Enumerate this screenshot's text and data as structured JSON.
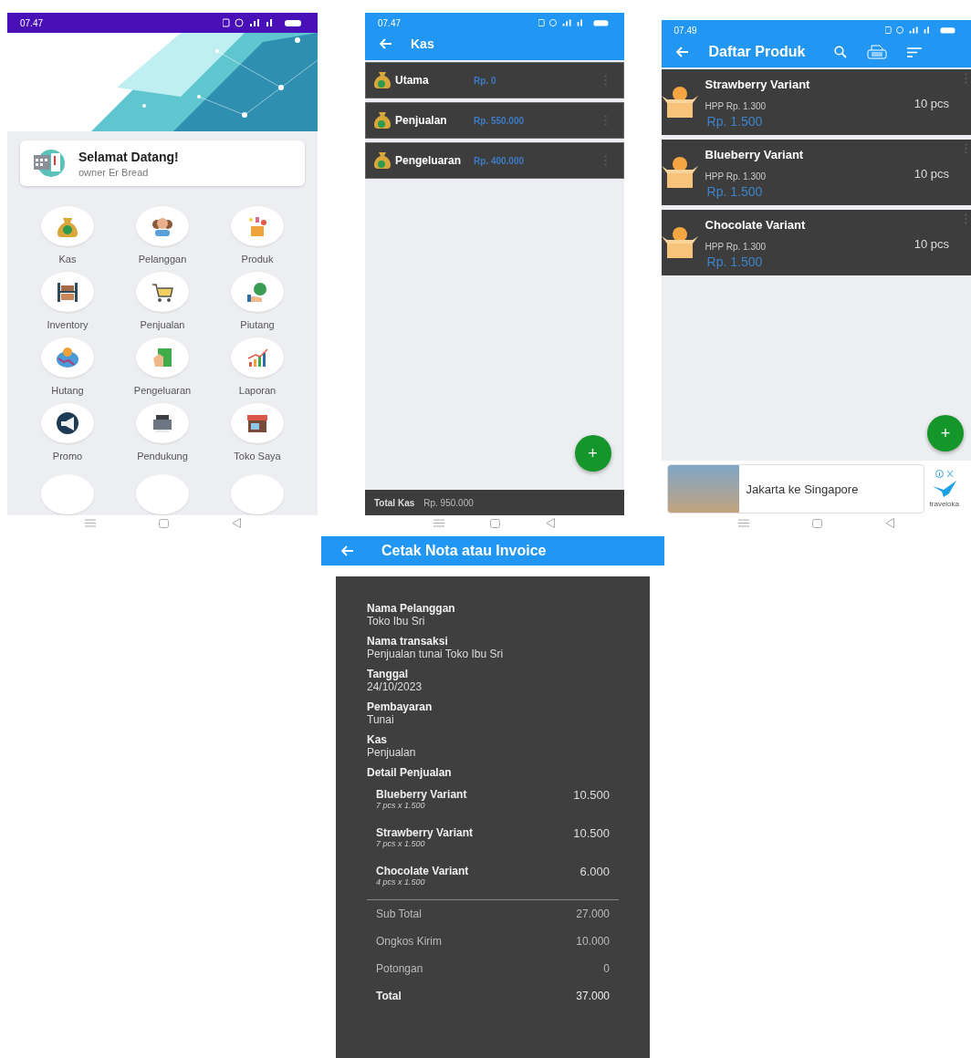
{
  "home_screen": {
    "status_time": "07.47",
    "welcome": {
      "title": "Selamat Datang!",
      "subtitle": "owner Er Bread"
    },
    "menu": [
      "Kas",
      "Pelanggan",
      "Produk",
      "Inventory",
      "Penjualan",
      "Piutang",
      "Hutang",
      "Pengeluaran",
      "Laporan",
      "Promo",
      "Pendukung",
      "Toko Saya"
    ]
  },
  "kas_screen": {
    "status_time": "07.47",
    "title": "Kas",
    "accounts": [
      {
        "name": "Utama",
        "amount": "Rp. 0"
      },
      {
        "name": "Penjualan",
        "amount": "Rp. 550.000"
      },
      {
        "name": "Pengeluaran",
        "amount": "Rp. 400.000"
      }
    ],
    "fab": "+",
    "footer": {
      "label": "Total Kas",
      "value": "Rp. 950.000"
    }
  },
  "product_screen": {
    "status_time": "07.49",
    "title": "Daftar Produk",
    "products": [
      {
        "name": "Strawberry Variant",
        "hpp": "HPP Rp. 1.300",
        "price": "Rp. 1.500",
        "stock": "10 pcs"
      },
      {
        "name": "Blueberry Variant",
        "hpp": "HPP Rp. 1.300",
        "price": "Rp. 1.500",
        "stock": "10 pcs"
      },
      {
        "name": "Chocolate Variant",
        "hpp": "HPP Rp. 1.300",
        "price": "Rp. 1.500",
        "stock": "10 pcs"
      }
    ],
    "fab": "+",
    "ad": {
      "text": "Jakarta ke Singapore",
      "brand": "traveloka"
    }
  },
  "invoice_screen": {
    "title": "Cetak Nota atau Invoice",
    "fields": [
      {
        "label": "Nama Pelanggan",
        "value": "Toko Ibu Sri"
      },
      {
        "label": "Nama transaksi",
        "value": "Penjualan tunai Toko Ibu Sri"
      },
      {
        "label": "Tanggal",
        "value": "24/10/2023"
      },
      {
        "label": "Pembayaran",
        "value": "Tunai"
      },
      {
        "label": "Kas",
        "value": "Penjualan"
      }
    ],
    "detail_heading": "Detail Penjualan",
    "items": [
      {
        "name": "Blueberry Variant",
        "qty": "7 pcs x 1.500",
        "amount": "10.500"
      },
      {
        "name": "Strawberry Variant",
        "qty": "7 pcs x 1.500",
        "amount": "10.500"
      },
      {
        "name": "Chocolate Variant",
        "qty": "4 pcs x 1.500",
        "amount": "6.000"
      }
    ],
    "totals": [
      {
        "label": "Sub Total",
        "value": "27.000",
        "emphasis": false
      },
      {
        "label": "Ongkos Kirim",
        "value": "10.000",
        "emphasis": false
      },
      {
        "label": "Potongan",
        "value": "0",
        "emphasis": false
      },
      {
        "label": "Total",
        "value": "37.000",
        "emphasis": true
      }
    ]
  }
}
